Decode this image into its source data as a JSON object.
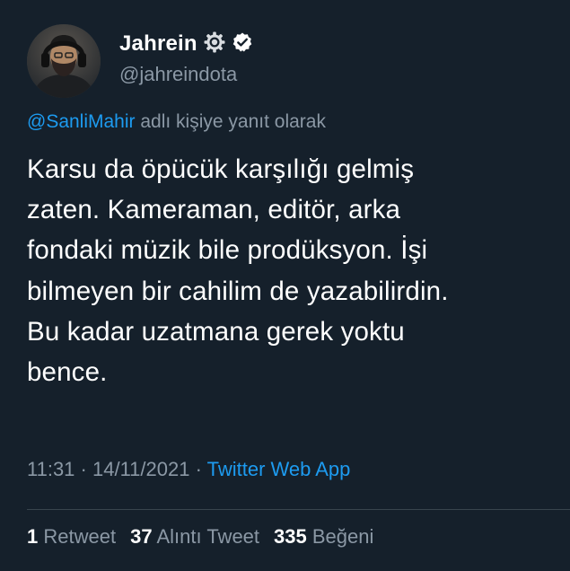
{
  "user": {
    "display_name": "Jahrein",
    "handle": "@jahreindota",
    "gear_icon": "gear-icon",
    "verified_icon": "verified-badge-icon"
  },
  "reply": {
    "mention": "@SanliMahir",
    "suffix": " adlı kişiye yanıt olarak"
  },
  "tweet": {
    "lines": [
      "Karsu da öpücük karşılığı gelmiş",
      "zaten. Kameraman, editör, arka",
      "fondaki müzik bile prodüksyon. İşi",
      "bilmeyen bir cahilim de yazabilirdin.",
      "Bu kadar uzatmana gerek yoktu",
      "bence."
    ]
  },
  "meta": {
    "time": "11:31",
    "separator1": " · ",
    "date": "14/11/2021",
    "separator2": " · ",
    "source": "Twitter Web App"
  },
  "stats": {
    "retweets_count": "1",
    "retweets_label": "Retweet",
    "quotes_count": "37",
    "quotes_label": "Alıntı Tweet",
    "likes_count": "335",
    "likes_label": "Beğeni"
  },
  "colors": {
    "background": "#15202b",
    "text_primary": "#ffffff",
    "text_secondary": "#8b98a5",
    "accent_blue": "#1d9bf0",
    "divider": "#38444d"
  }
}
